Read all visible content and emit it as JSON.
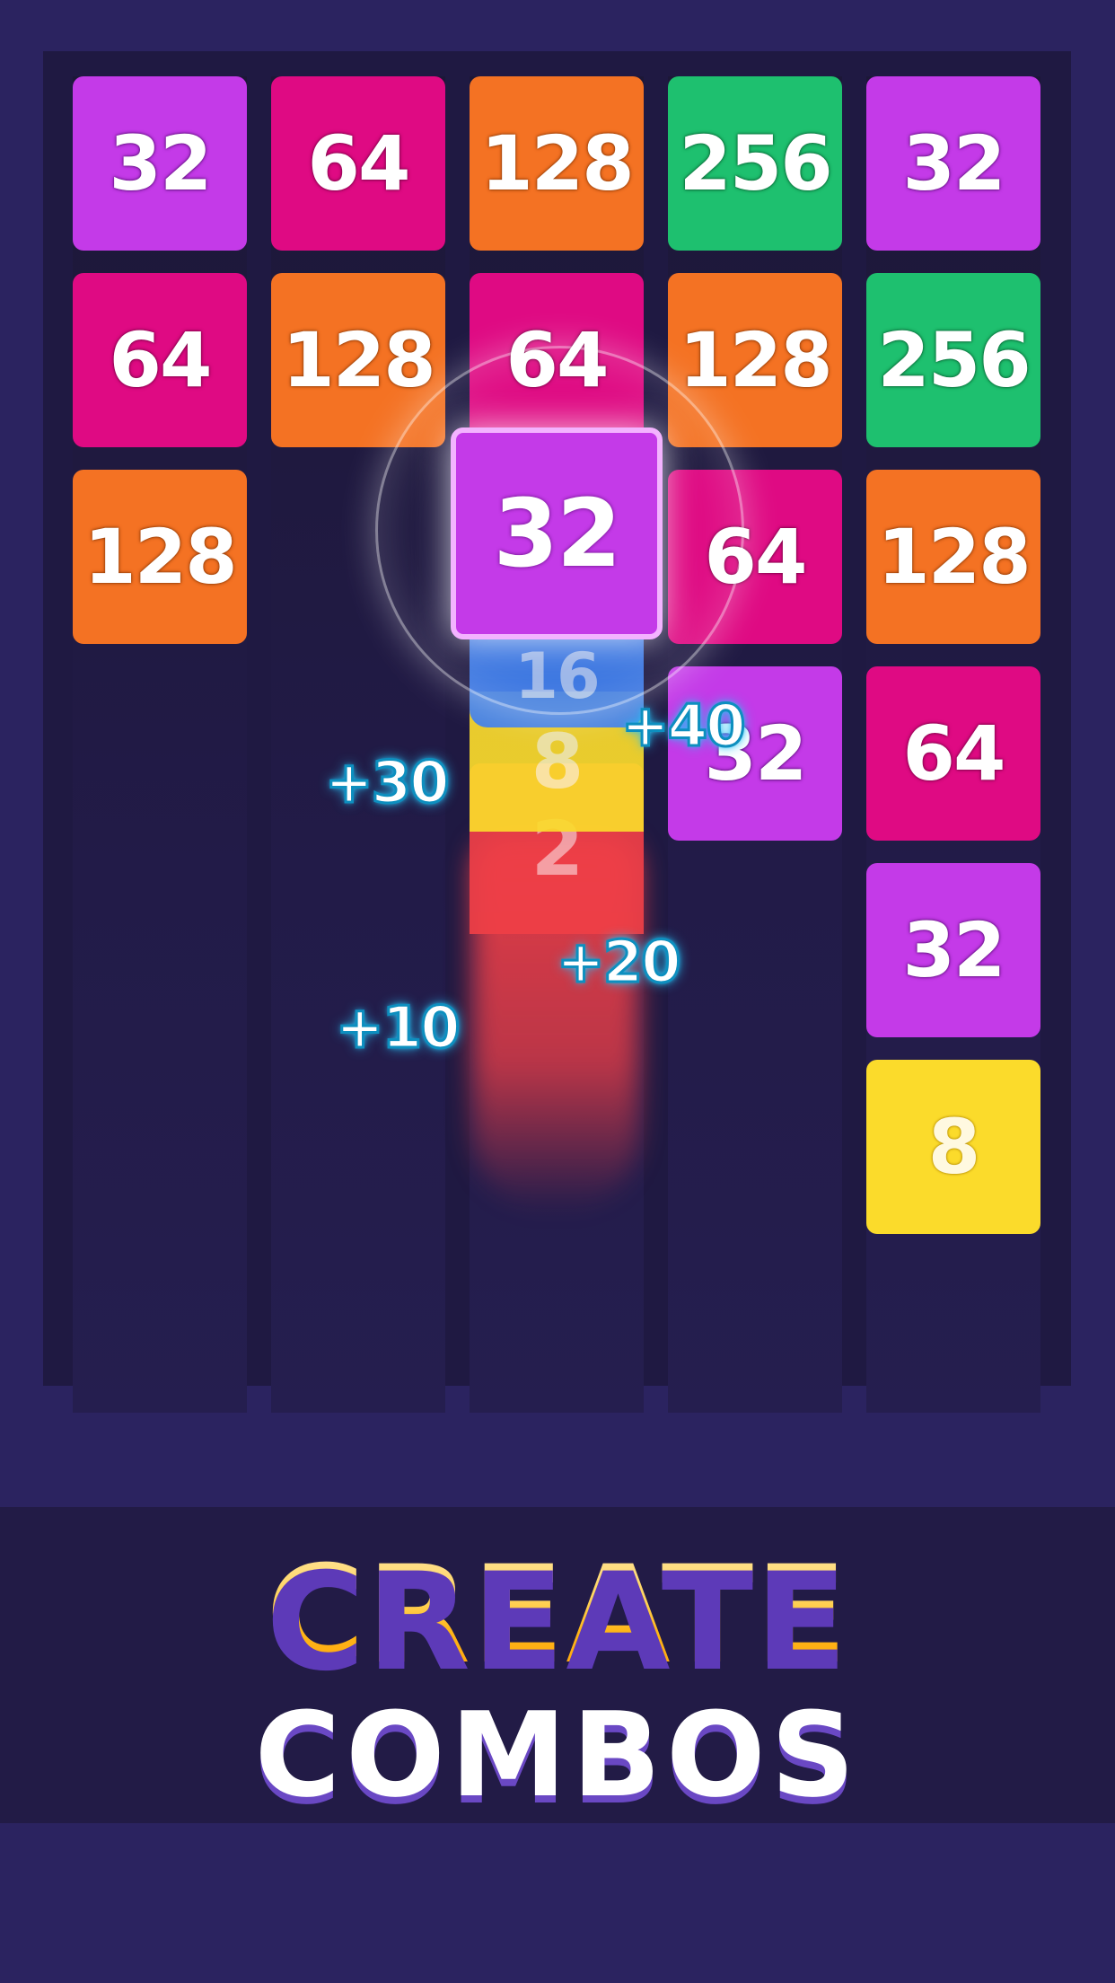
{
  "board": {
    "columns": [
      {
        "tiles": [
          {
            "value": "32",
            "color": "#c43ae8"
          },
          {
            "value": "64",
            "color": "#df0a83"
          },
          {
            "value": "128",
            "color": "#f47223"
          }
        ]
      },
      {
        "tiles": [
          {
            "value": "64",
            "color": "#df0a83"
          },
          {
            "value": "128",
            "color": "#f47223"
          }
        ]
      },
      {
        "tiles": [
          {
            "value": "128",
            "color": "#f47223"
          },
          {
            "value": "64",
            "color": "#df0a83"
          }
        ]
      },
      {
        "tiles": [
          {
            "value": "256",
            "color": "#1ec06f"
          },
          {
            "value": "128",
            "color": "#f47223"
          },
          {
            "value": "64",
            "color": "#df0a83"
          },
          {
            "value": "32",
            "color": "#c43ae8"
          }
        ]
      },
      {
        "tiles": [
          {
            "value": "32",
            "color": "#c43ae8"
          },
          {
            "value": "256",
            "color": "#1ec06f"
          },
          {
            "value": "128",
            "color": "#f47223"
          },
          {
            "value": "64",
            "color": "#df0a83"
          },
          {
            "value": "32",
            "color": "#c43ae8"
          },
          {
            "value": "8",
            "color": "#fbdb2b"
          }
        ]
      }
    ],
    "merging_stack": [
      "16",
      "8",
      "2"
    ],
    "active_tile": {
      "value": "32",
      "color": "#c43ae8"
    }
  },
  "score_popups": [
    "+40",
    "+30",
    "+20",
    "+10"
  ],
  "headline": {
    "line1": "CREATE",
    "line2": "COMBOS"
  },
  "colors": {
    "background": "#2b2360",
    "board": "#1f1942",
    "accent_gold": "#ffb617",
    "popup_glow": "#27c0f5"
  }
}
